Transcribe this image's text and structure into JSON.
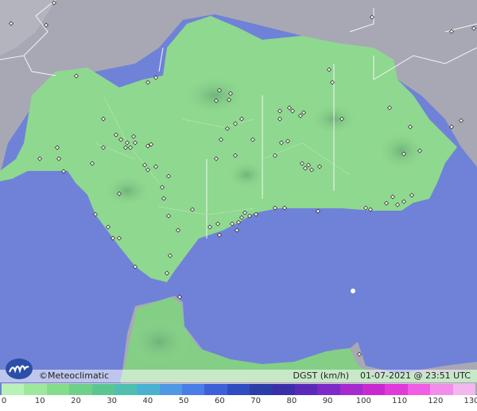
{
  "map": {
    "brand": "©Meteoclimatic",
    "variable": "DGST (km/h)",
    "date": "01-07-2021",
    "at": "@",
    "time": "23:51 UTC",
    "colors": {
      "sea": "#6f82d8",
      "land_low": "#8fd88f",
      "land_mid": "#78c97e",
      "terrain_gray": "#a8a8b4"
    }
  },
  "legend": {
    "ticks": [
      "0",
      "10",
      "20",
      "30",
      "40",
      "50",
      "60",
      "70",
      "80",
      "90",
      "100",
      "110",
      "120",
      "130"
    ],
    "colors": [
      "#b8f2b8",
      "#9ee89e",
      "#84dd8c",
      "#6fd08a",
      "#5cc693",
      "#4fbfb0",
      "#4ab2d0",
      "#4f98e4",
      "#4a7de8",
      "#3d60d8",
      "#2f4cc0",
      "#2c3ca8",
      "#3a2fa8",
      "#5a2bb8",
      "#7d2ac8",
      "#a52ad0",
      "#c82ad0",
      "#e03ad8",
      "#ef5ee4",
      "#f28eea",
      "#f4b6ef"
    ]
  }
}
